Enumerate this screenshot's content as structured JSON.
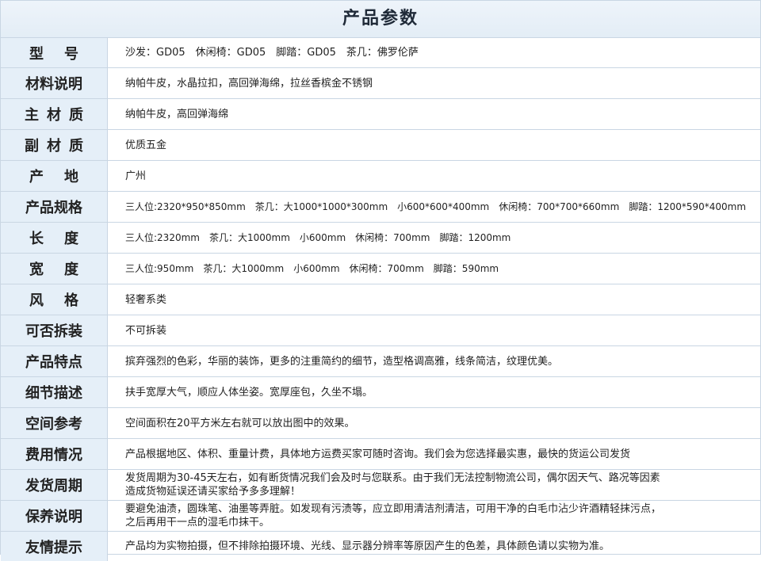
{
  "title": "产品参数",
  "rows": [
    {
      "label": "型号",
      "value": "沙发：GD05　休闲椅：GD05　脚踏：GD05　茶几：佛罗伦萨"
    },
    {
      "label": "材料说明",
      "value": "纳帕牛皮，水晶拉扣，高回弹海绵，拉丝香槟金不锈钢"
    },
    {
      "label": "主材质",
      "value": "纳帕牛皮，高回弹海绵"
    },
    {
      "label": "副材质",
      "value": "优质五金"
    },
    {
      "label": "产地",
      "value": "广州"
    },
    {
      "label": "产品规格",
      "value": "三人位:2320*950*850mm　茶几：大1000*1000*300mm　小600*600*400mm　休闲椅：700*700*660mm　脚踏：1200*590*400mm"
    },
    {
      "label": "长度",
      "value": "三人位:2320mm　茶几：大1000mm　小600mm　休闲椅：700mm　脚踏：1200mm"
    },
    {
      "label": "宽度",
      "value": "三人位:950mm　茶几：大1000mm　小600mm　休闲椅：700mm　脚踏：590mm"
    },
    {
      "label": "风格",
      "value": "轻奢系类"
    },
    {
      "label": "可否拆装",
      "value": "不可拆装"
    },
    {
      "label": "产品特点",
      "value": "摈弃强烈的色彩，华丽的装饰，更多的注重简约的细节，造型格调高雅，线条简洁，纹理优美。"
    },
    {
      "label": "细节描述",
      "value": "扶手宽厚大气，顺应人体坐姿。宽厚座包，久坐不塌。"
    },
    {
      "label": "空间参考",
      "value": "空间面积在20平方米左右就可以放出图中的效果。"
    },
    {
      "label": "费用情况",
      "value": "产品根据地区、体积、重量计费，具体地方运费买家可随时咨询。我们会为您选择最实惠，最快的货运公司发货"
    },
    {
      "label": "发货周期",
      "value": "发货周期为30-45天左右，如有断货情况我们会及时与您联系。由于我们无法控制物流公司，偶尔因天气、路况等因素\n造成货物延误还请买家给予多多理解！"
    },
    {
      "label": "保养说明",
      "value": "要避免油渍，圆珠笔、油墨等弄脏。如发现有污渍等，应立即用清洁剂清洁，可用干净的白毛巾沾少许酒精轻抹污点，\n之后再用干一点的湿毛巾抹干。"
    },
    {
      "label": "友情提示",
      "value": "产品均为实物拍摄，但不排除拍摄环境、光线、显示器分辨率等原因产生的色差，具体颜色请以实物为准。"
    }
  ]
}
